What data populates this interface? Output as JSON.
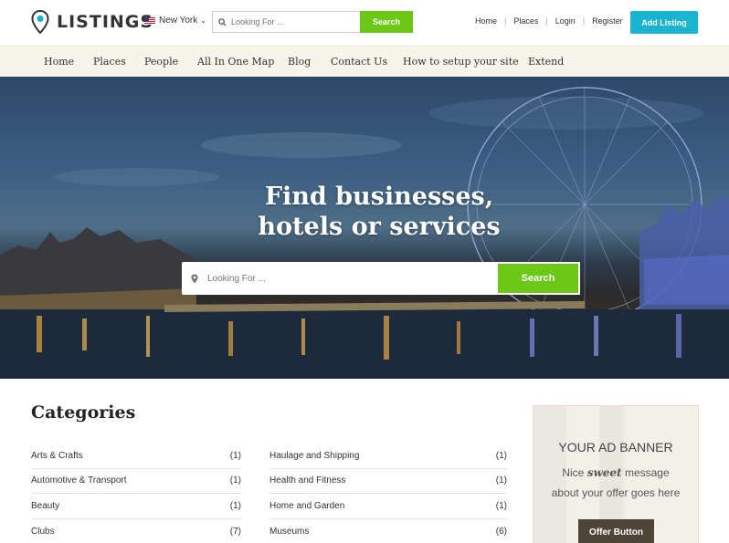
{
  "header": {
    "logo_text": "LISTINGS",
    "city": "New York",
    "search_placeholder": "Looking For ...",
    "search_button": "Search",
    "links": [
      "Home",
      "Places",
      "Login",
      "Register"
    ],
    "add_listing": "Add Listing"
  },
  "nav": {
    "items": [
      "Home",
      "Places",
      "People",
      "All In One Map",
      "Blog",
      "Contact Us",
      "How to setup your site",
      "Extend"
    ]
  },
  "hero": {
    "title_line1": "Find businesses,",
    "title_line2": "hotels or services",
    "search_placeholder": "Looking For ...",
    "search_button": "Search"
  },
  "categories": {
    "title": "Categories",
    "left": [
      {
        "name": "Arts & Crafts",
        "count": "(1)"
      },
      {
        "name": "Automotive & Transport",
        "count": "(1)"
      },
      {
        "name": "Beauty",
        "count": "(1)"
      },
      {
        "name": "Clubs",
        "count": "(7)"
      }
    ],
    "right": [
      {
        "name": "Haulage and Shipping",
        "count": "(1)"
      },
      {
        "name": "Health and Fitness",
        "count": "(1)"
      },
      {
        "name": "Home and Garden",
        "count": "(1)"
      },
      {
        "name": "Museums",
        "count": "(6)"
      }
    ]
  },
  "ad": {
    "title": "YOUR AD BANNER",
    "line1_pre": "Nice",
    "line1_em": "sweet",
    "line1_post": "message",
    "line2": "about your offer goes here",
    "button": "Offer Button"
  },
  "colors": {
    "accent_green": "#6cc717",
    "accent_blue": "#1ab3d1",
    "nav_bg": "#f7f4ea",
    "ad_button": "#4e4538"
  }
}
